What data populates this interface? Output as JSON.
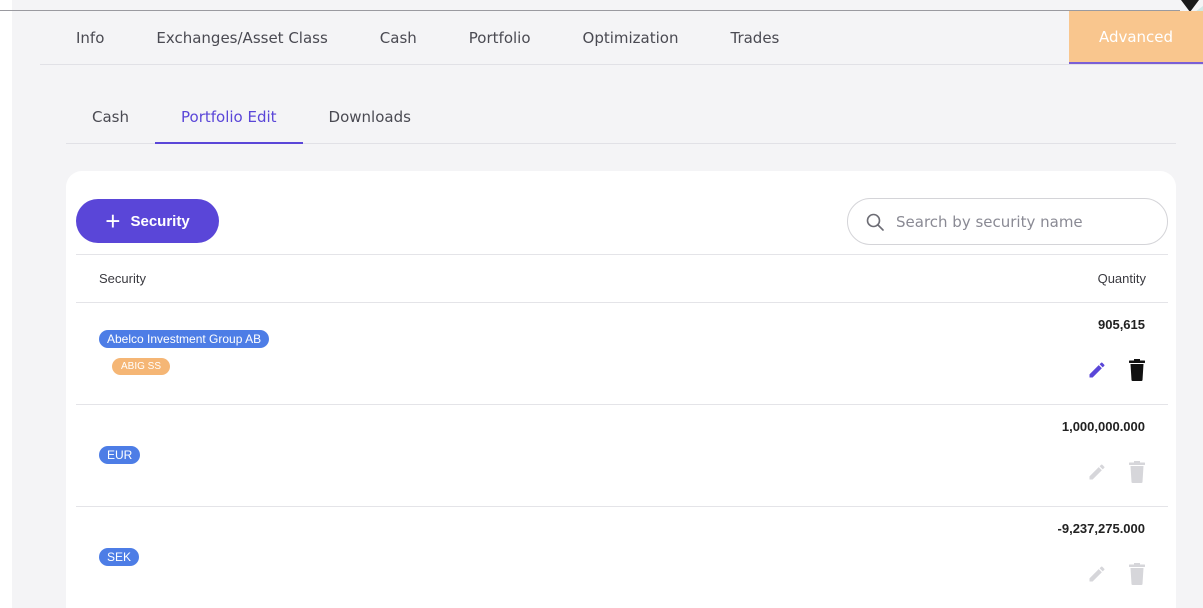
{
  "topnav": {
    "tabs": [
      {
        "label": "Info"
      },
      {
        "label": "Exchanges/Asset Class"
      },
      {
        "label": "Cash"
      },
      {
        "label": "Portfolio"
      },
      {
        "label": "Optimization"
      },
      {
        "label": "Trades"
      }
    ],
    "advanced_label": "Advanced"
  },
  "subnav": {
    "tabs": [
      {
        "label": "Cash",
        "active": false
      },
      {
        "label": "Portfolio Edit",
        "active": true
      },
      {
        "label": "Downloads",
        "active": false
      }
    ]
  },
  "toolbar": {
    "add_label": "Security",
    "search_placeholder": "Search by security name",
    "search_value": ""
  },
  "table": {
    "columns": {
      "security": "Security",
      "quantity": "Quantity"
    },
    "rows": [
      {
        "name": "Abelco Investment Group AB",
        "ticker": "ABIG SS",
        "quantity": "905,615",
        "actions_enabled": true
      },
      {
        "name": "EUR",
        "ticker": "",
        "quantity": "1,000,000.000",
        "actions_enabled": false
      },
      {
        "name": "SEK",
        "ticker": "",
        "quantity": "-9,237,275.000",
        "actions_enabled": false
      }
    ]
  },
  "colors": {
    "primary": "#5a46d8",
    "advanced_tab": "#f9c68e",
    "security_chip": "#4d7de6",
    "ticker_chip": "#f5b675",
    "action_disabled": "#d6d6da",
    "delete_enabled": "#111111"
  },
  "icons": {
    "add": "plus-icon",
    "search": "search-icon",
    "edit": "pencil-icon",
    "delete": "trash-icon"
  }
}
